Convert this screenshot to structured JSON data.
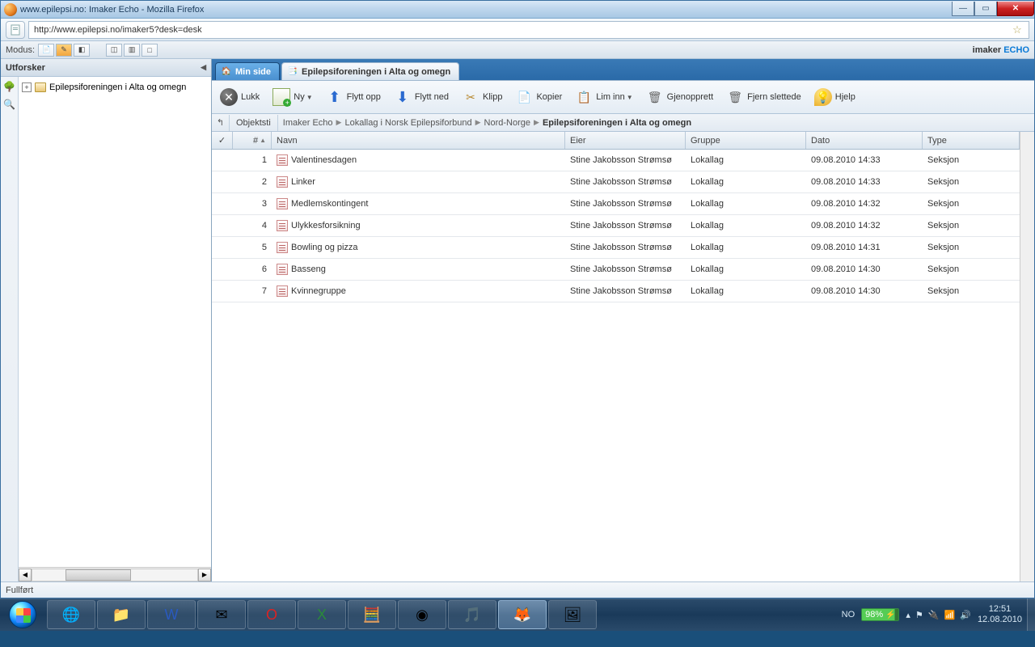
{
  "window": {
    "title": "www.epilepsi.no: Imaker Echo - Mozilla Firefox"
  },
  "url": "http://www.epilepsi.no/imaker5?desk=desk",
  "modebar": {
    "label": "Modus:"
  },
  "brand": {
    "a": "imaker",
    "b": "ECHO"
  },
  "sidebar": {
    "title": "Utforsker",
    "tree_root": "Epilepsiforeningen i Alta og omegn"
  },
  "tabs": [
    {
      "label": "Min side"
    },
    {
      "label": "Epilepsiforeningen i Alta og omegn"
    }
  ],
  "toolbar": {
    "lukk": "Lukk",
    "ny": "Ny",
    "flytt_opp": "Flytt opp",
    "flytt_ned": "Flytt ned",
    "klipp": "Klipp",
    "kopier": "Kopier",
    "lim_inn": "Lim inn",
    "gjenopprett": "Gjenopprett",
    "fjern_slettede": "Fjern slettede",
    "hjelp": "Hjelp"
  },
  "breadcrumb": {
    "label": "Objektsti",
    "path": [
      "Imaker Echo",
      "Lokallag i Norsk Epilepsiforbund",
      "Nord-Norge"
    ],
    "current": "Epilepsiforeningen i Alta og omegn"
  },
  "columns": {
    "chk": "✓",
    "num": "#",
    "navn": "Navn",
    "eier": "Eier",
    "gruppe": "Gruppe",
    "dato": "Dato",
    "type": "Type"
  },
  "rows": [
    {
      "n": "1",
      "navn": "Valentinesdagen",
      "eier": "Stine Jakobsson Strømsø",
      "gruppe": "Lokallag",
      "dato": "09.08.2010 14:33",
      "type": "Seksjon"
    },
    {
      "n": "2",
      "navn": "Linker",
      "eier": "Stine Jakobsson Strømsø",
      "gruppe": "Lokallag",
      "dato": "09.08.2010 14:33",
      "type": "Seksjon"
    },
    {
      "n": "3",
      "navn": "Medlemskontingent",
      "eier": "Stine Jakobsson Strømsø",
      "gruppe": "Lokallag",
      "dato": "09.08.2010 14:32",
      "type": "Seksjon"
    },
    {
      "n": "4",
      "navn": "Ulykkesforsikning",
      "eier": "Stine Jakobsson Strømsø",
      "gruppe": "Lokallag",
      "dato": "09.08.2010 14:32",
      "type": "Seksjon"
    },
    {
      "n": "5",
      "navn": "Bowling og pizza",
      "eier": "Stine Jakobsson Strømsø",
      "gruppe": "Lokallag",
      "dato": "09.08.2010 14:31",
      "type": "Seksjon"
    },
    {
      "n": "6",
      "navn": "Basseng",
      "eier": "Stine Jakobsson Strømsø",
      "gruppe": "Lokallag",
      "dato": "09.08.2010 14:30",
      "type": "Seksjon"
    },
    {
      "n": "7",
      "navn": "Kvinnegruppe",
      "eier": "Stine Jakobsson Strømsø",
      "gruppe": "Lokallag",
      "dato": "09.08.2010 14:30",
      "type": "Seksjon"
    }
  ],
  "status": "Fullført",
  "tray": {
    "lang": "NO",
    "battery": "98%",
    "time": "12:51",
    "date": "12.08.2010"
  }
}
